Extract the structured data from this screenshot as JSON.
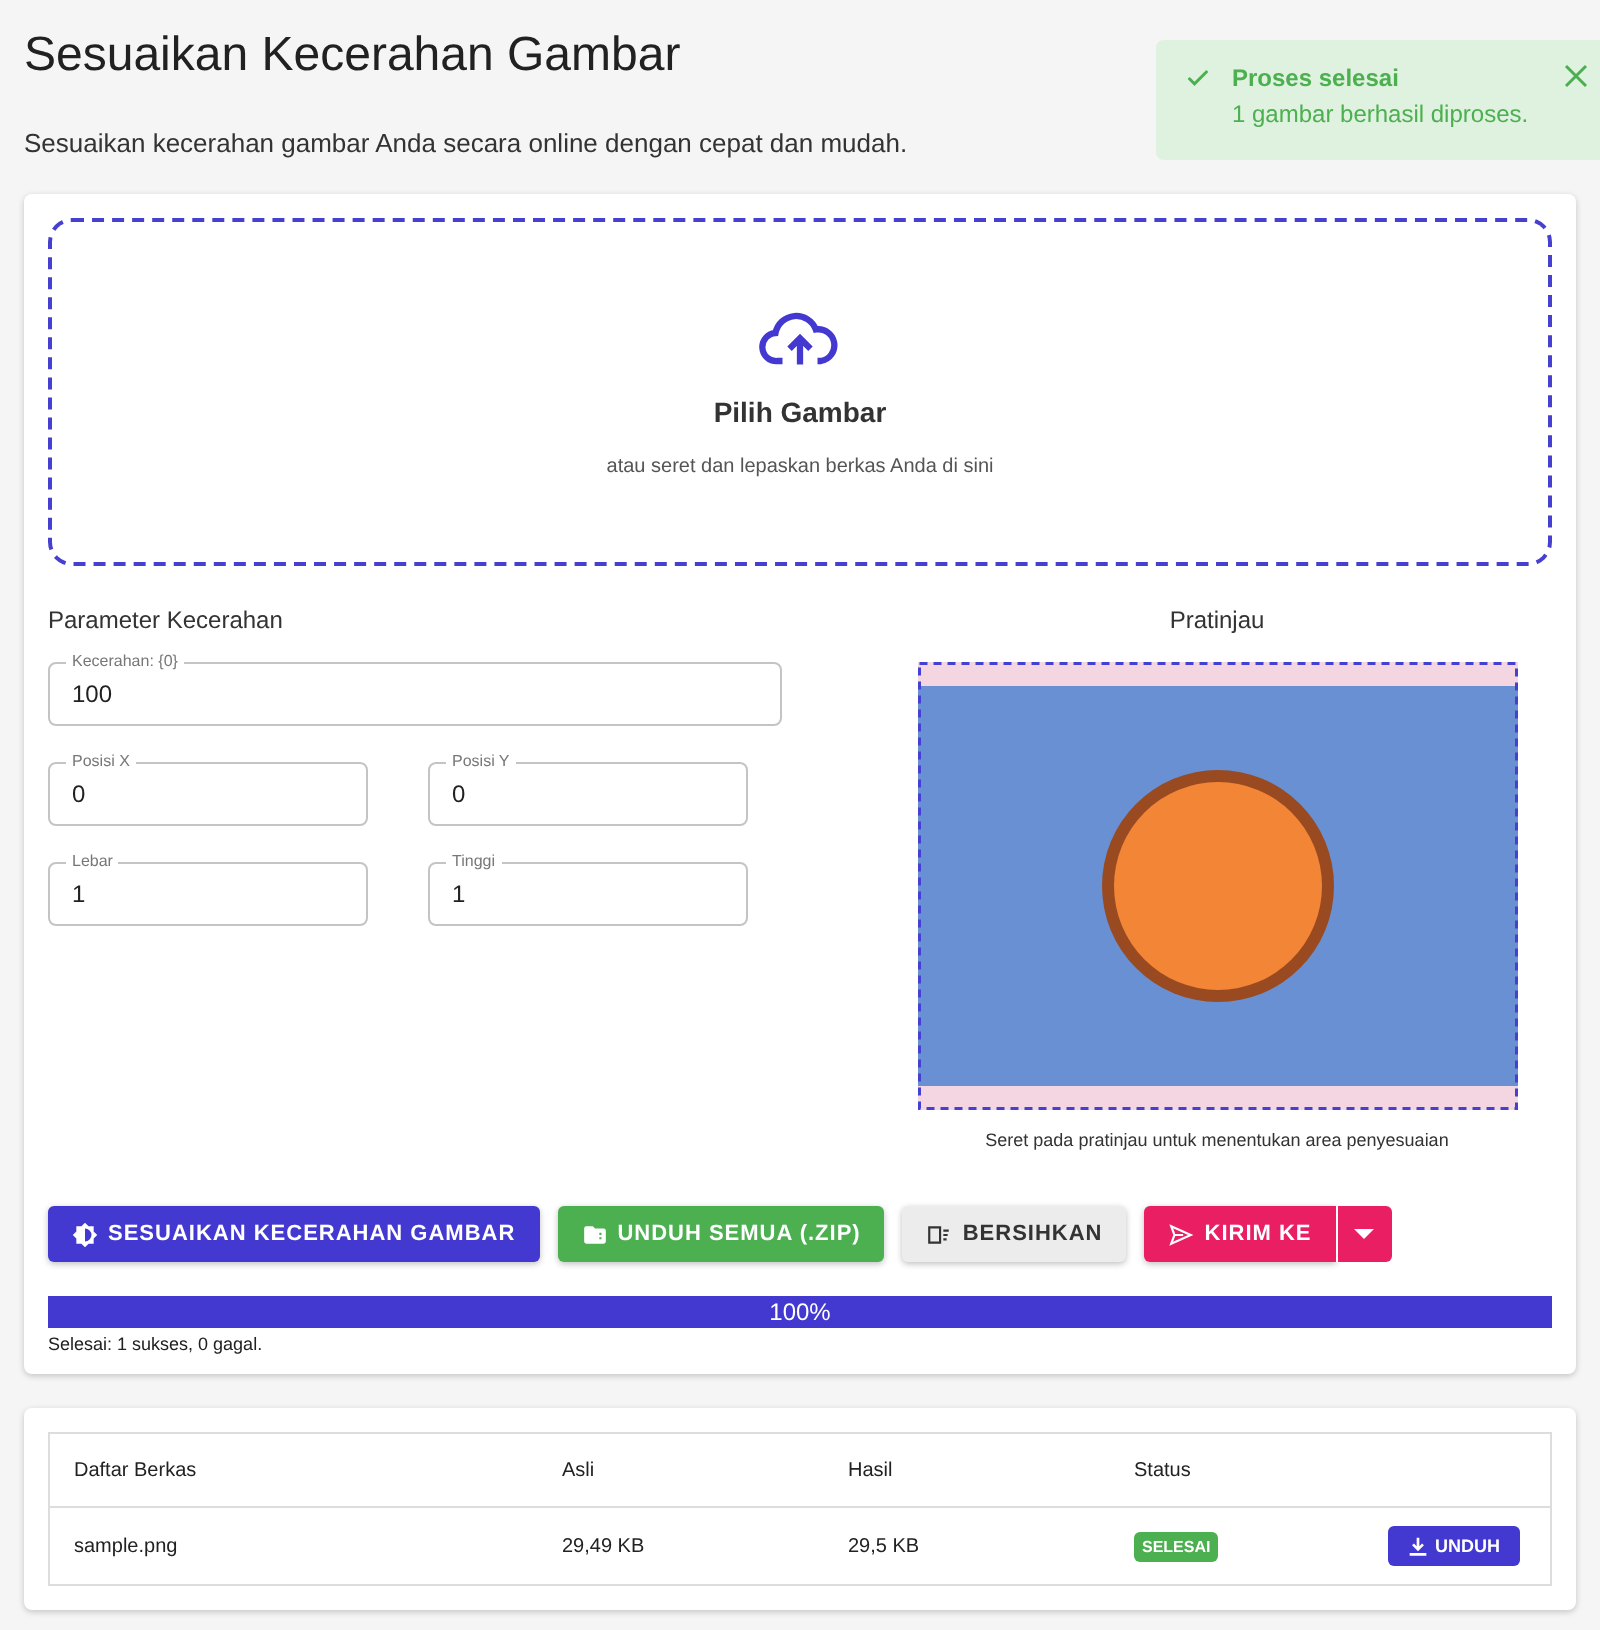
{
  "title": "Sesuaikan Kecerahan Gambar",
  "subtitle": "Sesuaikan kecerahan gambar Anda secara online dengan cepat dan mudah.",
  "toast": {
    "title": "Proses selesai",
    "message": "1 gambar berhasil diproses."
  },
  "dropzone": {
    "title": "Pilih Gambar",
    "hint": "atau seret dan lepaskan berkas Anda di sini"
  },
  "parameters": {
    "heading": "Parameter Kecerahan",
    "fields": [
      {
        "label": "Kecerahan: {0}",
        "value": "100"
      },
      {
        "label": "Posisi X",
        "value": "0"
      },
      {
        "label": "Posisi Y",
        "value": "0"
      },
      {
        "label": "Lebar",
        "value": "1"
      },
      {
        "label": "Tinggi",
        "value": "1"
      }
    ]
  },
  "preview": {
    "heading": "Pratinjau",
    "caption": "Seret pada pratinjau untuk menentukan area penyesuaian"
  },
  "buttons": [
    {
      "kind": "primary",
      "label": "SESUAIKAN KECERAHAN GAMBAR"
    },
    {
      "kind": "success",
      "label": "UNDUH SEMUA (.ZIP)"
    },
    {
      "kind": "neutral",
      "label": "BERSIHKAN"
    },
    {
      "kind": "send",
      "label": "KIRIM KE"
    }
  ],
  "progress": {
    "level": 1,
    "label": "100%",
    "summary": "Selesai: 1 sukses, 0 gagal."
  },
  "table": {
    "columns": [
      "Daftar Berkas",
      "Asli",
      "Hasil",
      "Status"
    ],
    "rows": [
      {
        "name": "sample.png",
        "original": "29,49 KB",
        "result": "29,5 KB",
        "status": "SELESAI",
        "color": "#4caf50",
        "action": "UNDUH"
      }
    ]
  }
}
